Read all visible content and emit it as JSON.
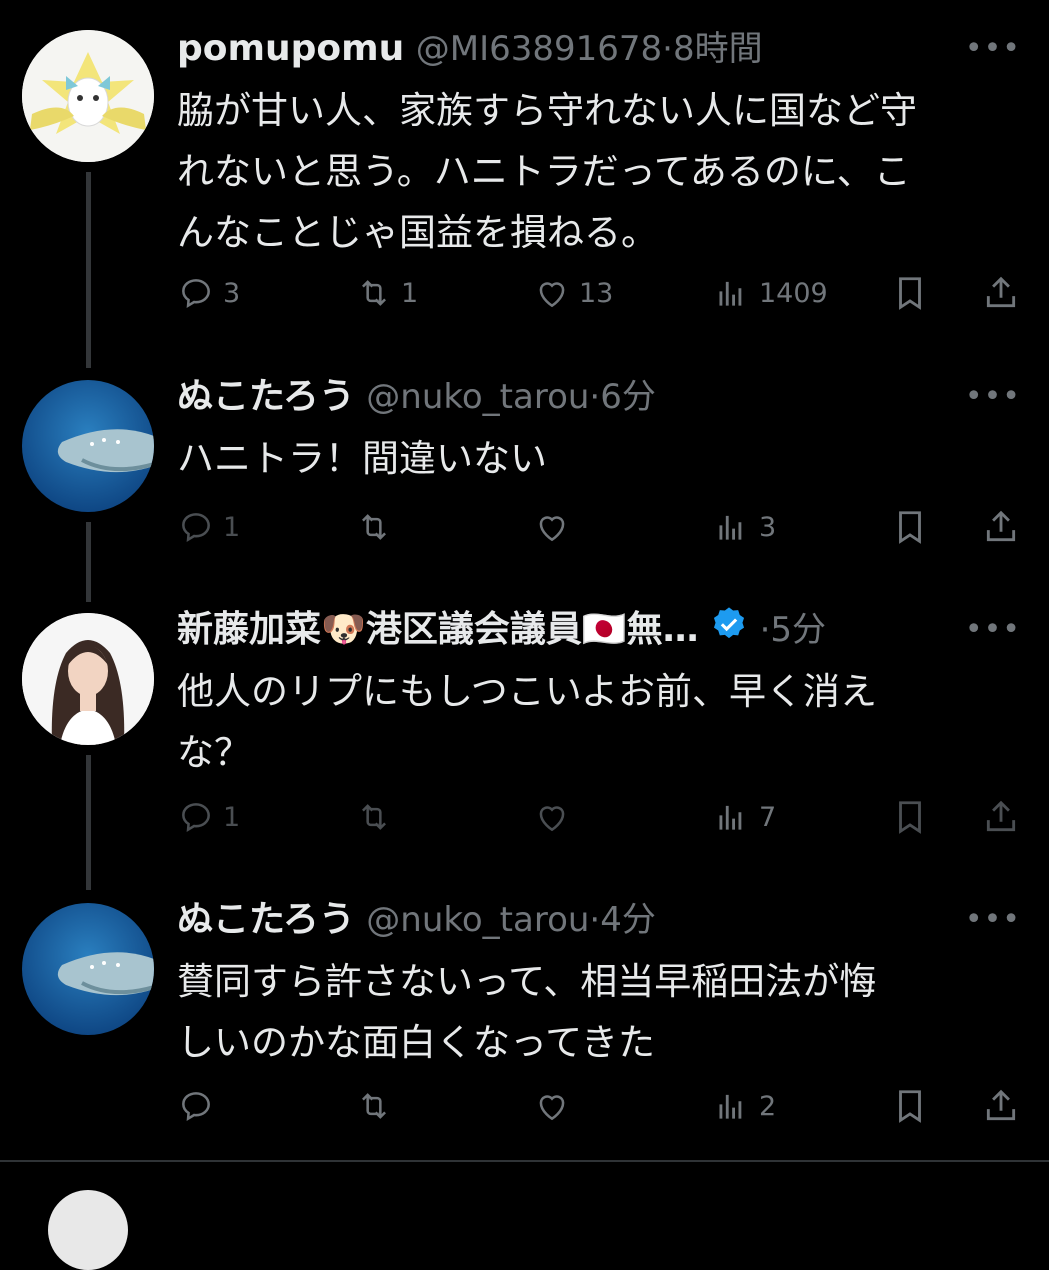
{
  "tweets": [
    {
      "name": "pomupomu",
      "handle": "@MI63891678",
      "time": "8時間",
      "text_lines": [
        "脇が甘い人、家族すら守れない人に国など守",
        "れないと思う。ハニトラだってあるのに、こ",
        "んなことじゃ国益を損ねる。"
      ],
      "replies": "3",
      "retweets": "1",
      "likes": "13",
      "views": "1409",
      "avatar": "pokemon-avatar"
    },
    {
      "name": "ぬこたろう",
      "handle": "@nuko_tarou",
      "time": "6分",
      "text_lines": [
        "ハニトラ！間違いない"
      ],
      "replies": "1",
      "retweets": "",
      "likes": "",
      "views": "3",
      "avatar": "whale-shark-avatar"
    },
    {
      "name": "新藤加菜🐶港区議会議員🇯🇵無…",
      "handle": "",
      "time": "5分",
      "verified": true,
      "text_lines": [
        "他人のリプにもしつこいよお前、早く消え",
        "な？"
      ],
      "replies": "1",
      "retweets": "",
      "likes": "",
      "views": "7",
      "avatar": "woman-portrait-avatar"
    },
    {
      "name": "ぬこたろう",
      "handle": "@nuko_tarou",
      "time": "4分",
      "text_lines": [
        "賛同すら許さないって、相当早稲田法が悔",
        "しいのかな面白くなってきた"
      ],
      "replies": "",
      "retweets": "",
      "likes": "",
      "views": "2",
      "avatar": "whale-shark-avatar"
    }
  ],
  "sep": "·",
  "more": "•••",
  "colors": {
    "background": "#000000",
    "text": "#e7e9ea",
    "muted": "#71767b",
    "verified": "#1d9bf0"
  }
}
